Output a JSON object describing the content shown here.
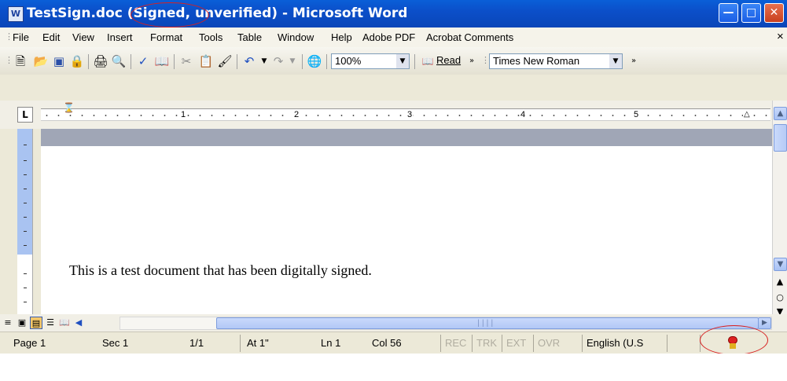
{
  "window": {
    "title": "TestSign.doc (Signed, unverified) - Microsoft Word",
    "app_icon": "word-doc-icon",
    "controls": {
      "minimize": "minimize-icon",
      "maximize": "maximize-icon",
      "close": "close-icon"
    }
  },
  "menu": {
    "items": [
      "File",
      "Edit",
      "View",
      "Insert",
      "Format",
      "Tools",
      "Table",
      "Window",
      "Help",
      "Adobe PDF",
      "Acrobat Comments"
    ],
    "close_glyph": "×"
  },
  "toolbar": {
    "zoom": "100%",
    "read_label": "Read",
    "font": "Times New Roman"
  },
  "ruler": {
    "corner_label": "L",
    "numbers": [
      "1",
      "2",
      "3",
      "4",
      "5"
    ]
  },
  "document": {
    "text": "This is a test document that has been digitally signed."
  },
  "status": {
    "page": "Page 1",
    "sec": "Sec 1",
    "pages": "1/1",
    "at": "At 1\"",
    "ln": "Ln 1",
    "col": "Col 56",
    "rec": "REC",
    "trk": "TRK",
    "ext": "EXT",
    "ovr": "OVR",
    "language": "English (U.S",
    "signature_icon": "digital-signature-icon"
  },
  "colors": {
    "titlebar": "#0a5fd8",
    "annotation": "#d82020",
    "page_band": "#a0a6b6"
  }
}
